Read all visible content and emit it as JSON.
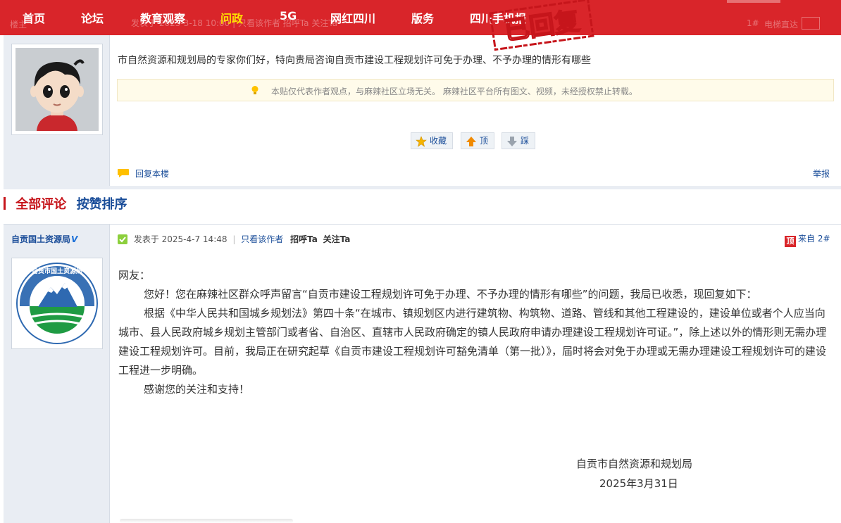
{
  "nav": {
    "items": [
      {
        "label": "首页",
        "active": false
      },
      {
        "label": "论坛",
        "active": false
      },
      {
        "label": "教育观察",
        "active": false
      },
      {
        "label": "问政",
        "active": true
      },
      {
        "label": "5G",
        "active": false
      },
      {
        "label": "网红四川",
        "active": false
      },
      {
        "label": "版务",
        "active": false
      },
      {
        "label": "四川手机报",
        "active": false
      }
    ],
    "stamp_text": "已回复",
    "underlay_left": "楼主",
    "underlay_meta": "发表于 2025-3-18 10:00 | 只看该作者  招呼Ta  关注Ta",
    "underlay_floor": "1#",
    "underlay_elevator": "电梯直达"
  },
  "post1": {
    "text": "市自然资源和规划局的专家你们好，特向贵局咨询自贡市建设工程规划许可免于办理、不予办理的情形有哪些",
    "notice": "本贴仅代表作者观点，与麻辣社区立场无关。  麻辣社区平台所有图文、视频，未经授权禁止转载。",
    "fav_label": "收藏",
    "up_label": "顶",
    "down_label": "踩",
    "reply_label": "回复本楼",
    "report_label": "举报"
  },
  "section": {
    "all_label": "全部评论",
    "sort_label": "按赞排序"
  },
  "post2": {
    "author": "自贡国土资源局",
    "verified": "V",
    "posted": "发表于 2025-4-7 14:48",
    "only_author": "只看该作者",
    "greet": "招呼Ta",
    "follow": "关注Ta",
    "from_badge": "顶",
    "from_label": "来自 2#",
    "logo_text": "自贡市国土资源局",
    "salutation": "网友：",
    "para1": "您好！您在麻辣社区群众呼声留言“自贡市建设工程规划许可免于办理、不予办理的情形有哪些”的问题，我局已收悉，现回复如下：",
    "para2": "根据《中华人民共和国城乡规划法》第四十条“在城市、镇规划区内进行建筑物、构筑物、道路、管线和其他工程建设的，建设单位或者个人应当向城市、县人民政府城乡规划主管部门或者省、自治区、直辖市人民政府确定的镇人民政府申请办理建设工程规划许可证。”，除上述以外的情形则无需办理建设工程规划许可。目前，我局正在研究起草《自贡市建设工程规划许可豁免清单（第一批）》，届时将会对免于办理或无需办理建设工程规划许可的建设工程进一步明确。",
    "para3": "感谢您的关注和支持！",
    "sign_org": "自贡市自然资源和规划局",
    "sign_date": "2025年3月31日"
  }
}
